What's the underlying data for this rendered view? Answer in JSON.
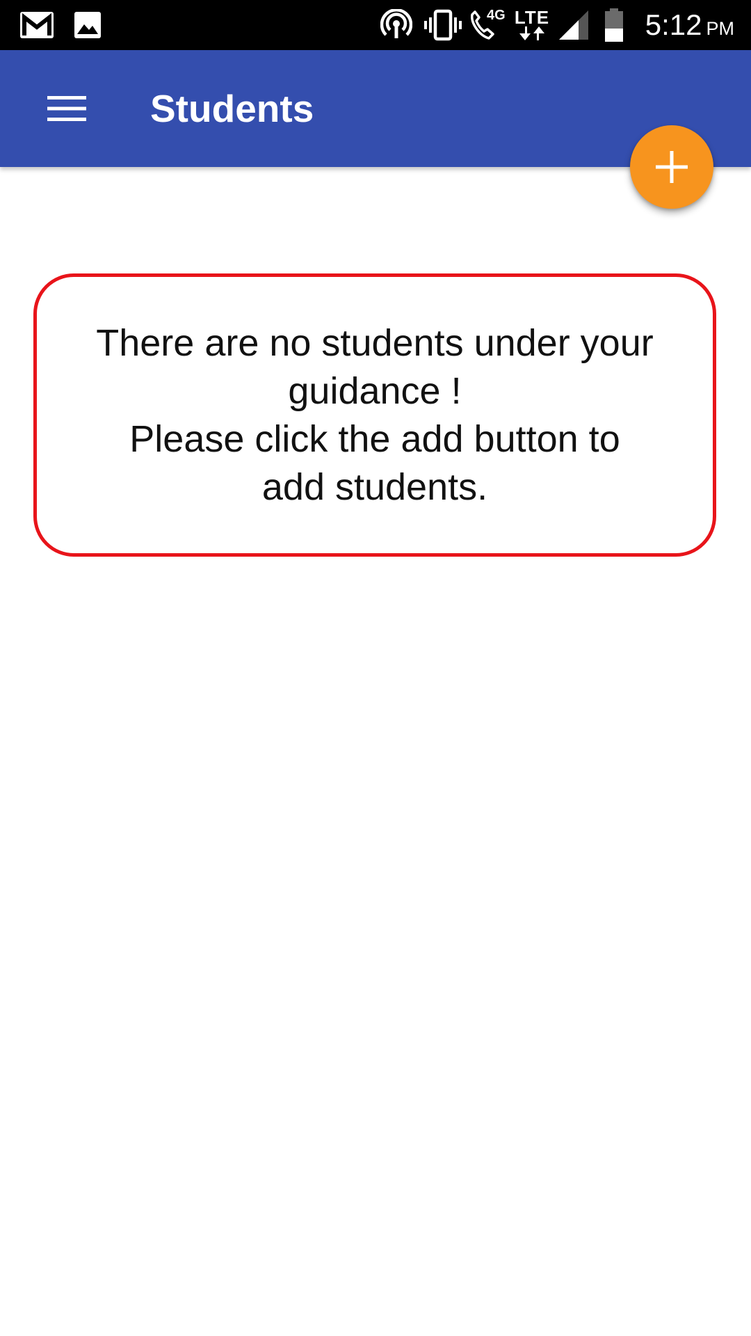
{
  "status_bar": {
    "time": "5:12",
    "ampm": "PM",
    "network_type": "4G",
    "network_label": "LTE",
    "icons": {
      "left": [
        "gmail-icon",
        "image-icon"
      ],
      "right": [
        "hotspot-icon",
        "vibrate-icon",
        "wifi-calling-icon",
        "lte-data-icon",
        "signal-icon",
        "battery-icon"
      ]
    }
  },
  "app_bar": {
    "title": "Students",
    "menu_icon": "hamburger-menu-icon",
    "color": "#344eae"
  },
  "fab": {
    "icon": "plus-icon",
    "color": "#f7941e"
  },
  "empty_state": {
    "lines": [
      "There are no students under your",
      "guidance !",
      "Please click the add button to",
      "add students."
    ],
    "border_color": "#e8141a"
  }
}
